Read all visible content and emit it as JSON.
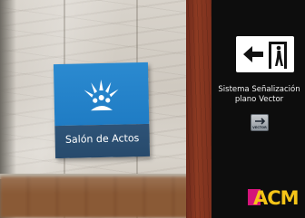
{
  "sign": {
    "label": "Salón de Actos",
    "icon": "conference-hall-icon",
    "colors": {
      "top": "#1f7cc4",
      "bottom": "#274a6c"
    }
  },
  "panel": {
    "exit_icon": "emergency-exit-arrow-icon",
    "line1": "Sistema Señalización",
    "line2": "plano Vector",
    "vector_logo": "VECTOR",
    "brand_logo": "ACM"
  }
}
